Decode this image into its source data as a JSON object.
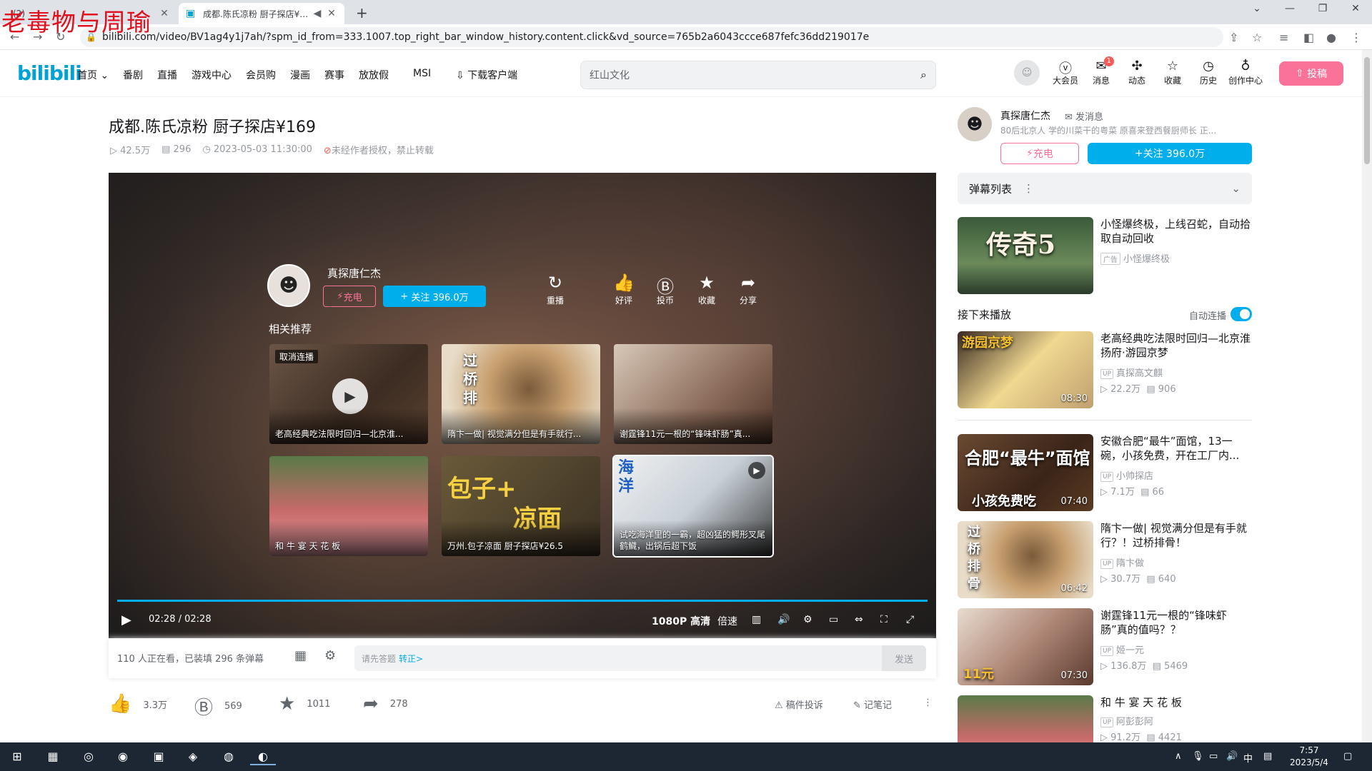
{
  "browser": {
    "watermark": "老毒物与周瑜",
    "inactive_tab_title": "(2)",
    "active_tab_title": "成都.陈氏凉粉 厨子探店¥169",
    "url": "bilibili.com/video/BV1ag4y1j7ah/?spm_id_from=333.1007.top_right_bar_window_history.content.click&vd_source=765b2a6043ccce687fefc36dd219017e"
  },
  "header": {
    "logo": "bilibili",
    "nav": [
      "首页",
      "番剧",
      "直播",
      "游戏中心",
      "会员购",
      "漫画",
      "赛事",
      "放放假",
      "MSI",
      "下载客户端"
    ],
    "search_placeholder": "红山文化",
    "icons": [
      {
        "label": "大会员",
        "icon": "vip-icon"
      },
      {
        "label": "消息",
        "icon": "message-icon",
        "badge": "1"
      },
      {
        "label": "动态",
        "icon": "dynamic-icon"
      },
      {
        "label": "收藏",
        "icon": "favorite-icon"
      },
      {
        "label": "历史",
        "icon": "history-icon"
      },
      {
        "label": "创作中心",
        "icon": "creator-icon"
      }
    ],
    "upload": "投稿"
  },
  "video": {
    "title": "成都.陈氏凉粉 厨子探店¥169",
    "views": "42.5万",
    "danmaku": "296",
    "date": "2023-05-03 11:30:00",
    "copyright": "未经作者授权，禁止转载"
  },
  "player": {
    "up_name": "真探唐仁杰",
    "charge": "充电",
    "follow": "关注 396.0万",
    "replay": "重播",
    "like": "好评",
    "coin": "投币",
    "collect": "收藏",
    "share": "分享",
    "related_title": "相关推荐",
    "cancel_autoplay": "取消连播",
    "progress": 1.0,
    "time_current": "02:28",
    "time_total": "02:28",
    "quality": "1080P 高清",
    "speed": "倍速",
    "recs": [
      {
        "caption": "老高经典吃法限时回归—北京淮..."
      },
      {
        "caption": "隋卞一做| 视觉满分但是有手就行..."
      },
      {
        "caption": "谢霆锋11元一根的“锋味虾肠”真..."
      },
      {
        "caption": "和 牛 宴 天 花 板"
      },
      {
        "caption": "万州.包子凉面 厨子探店¥26.5"
      },
      {
        "caption": "试吃海洋里的一霸，超凶猛的鳄形叉尾鹤鱵，出锅后超下饭"
      }
    ]
  },
  "danmaku_bar": {
    "watching": "110 人正在看，已装填 296 条弹幕",
    "placeholder": "请先答题",
    "link": "转正>",
    "send": "发送"
  },
  "toolbar": {
    "like": "3.3万",
    "coin": "569",
    "favorite": "1011",
    "share": "278",
    "report": "稿件投诉",
    "note": "记笔记"
  },
  "sidebar": {
    "up_name": "真探唐仁杰",
    "msg": "发消息",
    "desc": "80后北京人 学的川菜干的粤菜 原喜来登西餐厨师长 正...",
    "charge": "充电",
    "follow": "关注 396.0万",
    "danmaku_list": "弹幕列表",
    "ad": {
      "title": "小怪爆终极，上线召蛇，自动拾取自动回收",
      "tag": "广告",
      "source": "小怪爆终极"
    },
    "next_label": "接下来播放",
    "autoplay_label": "自动连播",
    "autoplay_on": true,
    "videos": [
      {
        "title": "老高经典吃法限时回归—北京淮扬府·游园京梦",
        "up": "真探高文麒",
        "views": "22.2万",
        "dm": "906",
        "duration": "08:30"
      },
      {
        "title": "安徽合肥“最牛”面馆，13一碗，小孩免费，开在工厂内...",
        "up": "小帅探店",
        "views": "7.1万",
        "dm": "66",
        "duration": "07:40"
      },
      {
        "title": "隋卞一做| 视觉满分但是有手就行？！过桥排骨！",
        "up": "隋卞做",
        "views": "30.7万",
        "dm": "640",
        "duration": "06:42"
      },
      {
        "title": "谢霆锋11元一根的“锋味虾肠”真的值吗？？",
        "up": "姬一元",
        "views": "136.8万",
        "dm": "5469",
        "duration": "07:30"
      },
      {
        "title": "和 牛 宴 天 花 板",
        "up": "阿彭彭阿",
        "views": "91.2万",
        "dm": "4421",
        "duration": ""
      }
    ]
  },
  "taskbar": {
    "time": "7:57",
    "date": "2023/5/4",
    "ime": "中"
  }
}
